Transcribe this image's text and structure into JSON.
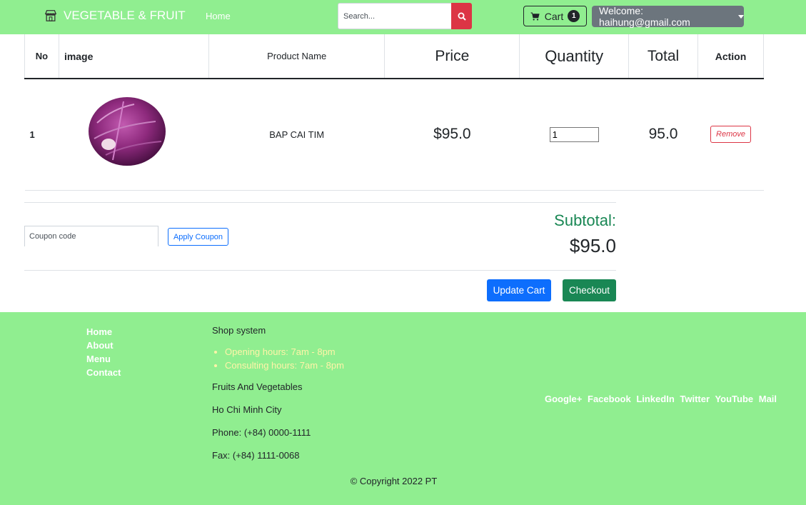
{
  "navbar": {
    "brand": "VEGETABLE & FRUIT",
    "home": "Home",
    "search_placeholder": "Search...",
    "cart_label": "Cart",
    "cart_count": "1",
    "user_label": "Welcome: haihung@gmail.com"
  },
  "table": {
    "headers": {
      "no": "No",
      "image": "image",
      "product_name": "Product Name",
      "price": "Price",
      "quantity": "Quantity",
      "total": "Total",
      "action": "Action"
    },
    "rows": [
      {
        "no": "1",
        "name": "BAP CAI TIM",
        "price": "$95.0",
        "quantity": "1",
        "total": "95.0",
        "remove_label": "Remove"
      }
    ]
  },
  "coupon": {
    "placeholder": "Coupon code",
    "apply_label": "Apply Coupon"
  },
  "summary": {
    "subtotal_label": "Subtotal:",
    "subtotal_value": "$95.0",
    "update_label": "Update Cart",
    "checkout_label": "Checkout"
  },
  "footer": {
    "links": [
      "Home",
      "About",
      "Menu",
      "Contact"
    ],
    "shop_title": "Shop system",
    "hours": [
      "Opening hours: 7am - 8pm",
      "Consulting hours: 7am - 8pm"
    ],
    "category": "Fruits And Vegetables",
    "city": "Ho Chi Minh City",
    "phone": "Phone: (+84) 0000-1111",
    "fax": "Fax: (+84) 1111-0068",
    "social": [
      "Google+",
      "Facebook",
      "LinkedIn",
      "Twitter",
      "YouTube",
      "Mail"
    ],
    "copyright": "© Copyright 2022 PT"
  },
  "colors": {
    "header_bg": "#90ee90",
    "danger": "#dc3545",
    "primary": "#0d6efd",
    "success": "#198754",
    "secondary": "#6c757d"
  }
}
